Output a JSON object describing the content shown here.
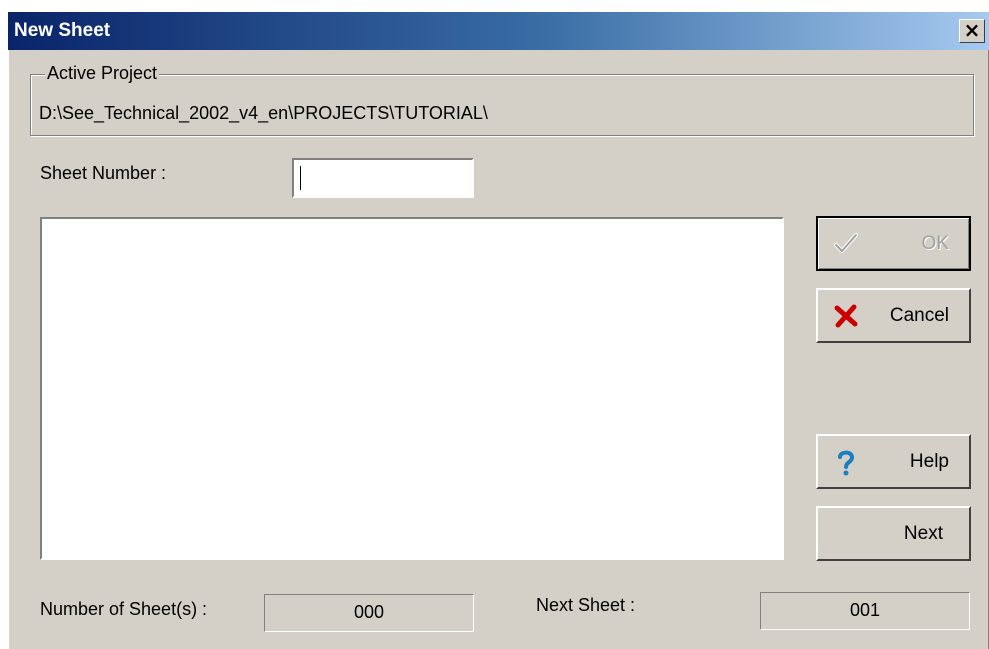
{
  "window": {
    "title": "New Sheet",
    "close_glyph": "×"
  },
  "active_project": {
    "legend": "Active Project",
    "path": "D:\\See_Technical_2002_v4_en\\PROJECTS\\TUTORIAL\\"
  },
  "sheet_number": {
    "label": "Sheet Number :",
    "value": ""
  },
  "sheet_list": {
    "items": []
  },
  "buttons": {
    "ok": {
      "label": "OK",
      "icon": "checkmark-icon",
      "enabled": false
    },
    "cancel": {
      "label": "Cancel",
      "icon": "red-x-icon"
    },
    "help": {
      "label": "Help",
      "icon": "question-mark-icon"
    },
    "next": {
      "label": "Next"
    }
  },
  "footer": {
    "count_label": "Number of Sheet(s) :",
    "count_value": "000",
    "next_label": "Next Sheet :",
    "next_value": "001"
  },
  "colors": {
    "titlebar_start": "#0a246a",
    "titlebar_end": "#a6caf0",
    "face": "#d4d0c8",
    "cancel_x": "#cc0000",
    "help_question": "#1a7fbf"
  }
}
